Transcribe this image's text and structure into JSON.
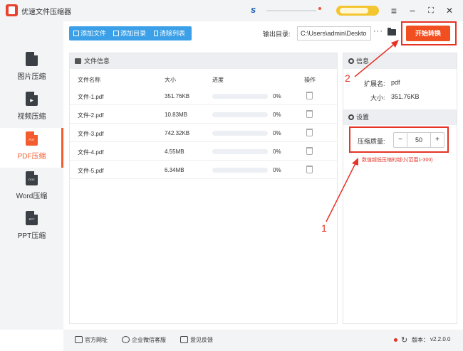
{
  "app": {
    "title": "优速文件压缩器",
    "version_label": "版本：",
    "version": "v2.2.0.0"
  },
  "promo": {
    "letter": "s"
  },
  "window_controls": {
    "menu": "≡",
    "minimize": "−",
    "maximize": "⛶",
    "close": "✕"
  },
  "sidebar": {
    "items": [
      {
        "label": "图片压缩",
        "icon": "image-file-icon",
        "icon_text": ""
      },
      {
        "label": "视频压缩",
        "icon": "video-file-icon",
        "icon_text": "▶"
      },
      {
        "label": "PDF压缩",
        "icon": "pdf-file-icon",
        "icon_text": "PDF",
        "active": true
      },
      {
        "label": "Word压缩",
        "icon": "doc-file-icon",
        "icon_text": "DOC"
      },
      {
        "label": "PPT压缩",
        "icon": "ppt-file-icon",
        "icon_text": "PPT"
      }
    ]
  },
  "toolbar": {
    "add_file": "添加文件",
    "add_folder": "添加目录",
    "clear_list": "清除列表"
  },
  "output": {
    "label": "输出目录:",
    "path": "C:\\Users\\admin\\Deskto",
    "more": "···"
  },
  "start_button": "开始转换",
  "file_panel": {
    "title": "文件信息",
    "columns": [
      "文件名称",
      "大小",
      "进度",
      "操作"
    ],
    "rows": [
      {
        "name": "文件-1.pdf",
        "size": "351.76KB",
        "progress": 0,
        "progress_text": "0%"
      },
      {
        "name": "文件-2.pdf",
        "size": "10.83MB",
        "progress": 0,
        "progress_text": "0%"
      },
      {
        "name": "文件-3.pdf",
        "size": "742.32KB",
        "progress": 0,
        "progress_text": "0%"
      },
      {
        "name": "文件-4.pdf",
        "size": "4.55MB",
        "progress": 0,
        "progress_text": "0%"
      },
      {
        "name": "文件-5.pdf",
        "size": "6.34MB",
        "progress": 0,
        "progress_text": "0%"
      }
    ]
  },
  "info_panel": {
    "title": "信息",
    "ext_label": "扩展名:",
    "ext_value": "pdf",
    "size_label": "大小:",
    "size_value": "351.76KB"
  },
  "settings_panel": {
    "title": "设置",
    "quality_label": "压缩质量:",
    "quality_value": "50",
    "minus": "−",
    "plus": "+",
    "hint": "数值越低压缩的越小(范围1-300)"
  },
  "footer": {
    "website": "官方网址",
    "wechat": "企业微信客服",
    "feedback": "意见反馈"
  },
  "annotations": {
    "step1": "1",
    "step2": "2"
  },
  "colors": {
    "accent": "#f24f21",
    "blue": "#3ba0e8",
    "annotation": "#e53325"
  }
}
